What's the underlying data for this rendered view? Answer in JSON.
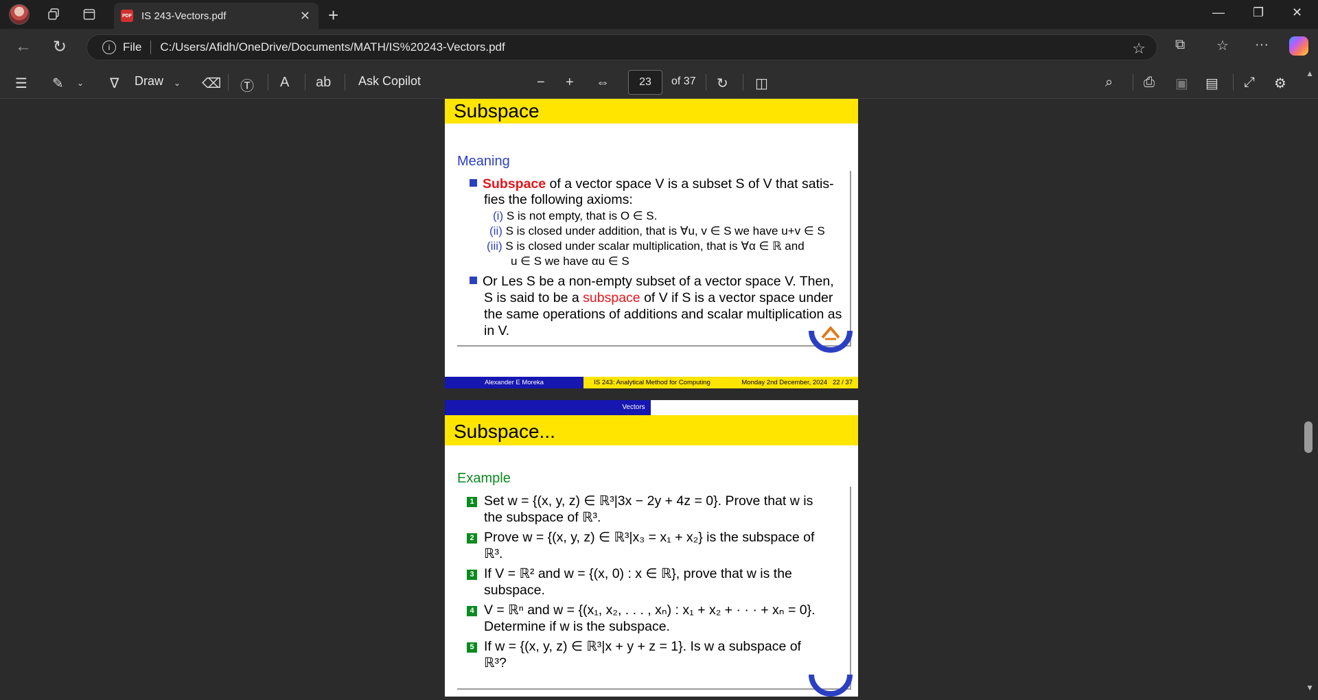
{
  "browser": {
    "tab_title": "IS 243-Vectors.pdf",
    "pdf_badge": "PDF",
    "file_label": "File",
    "url": "C:/Users/Afidh/OneDrive/Documents/MATH/IS%20243-Vectors.pdf"
  },
  "toolbar": {
    "draw_label": "Draw",
    "ask_copilot_label": "Ask Copilot",
    "translate_glyph": "ab",
    "read_aloud_glyph": "A",
    "page_current": "23",
    "page_total": "of 37"
  },
  "slide1": {
    "title": "Subspace",
    "block_title": "Meaning",
    "b1_red": "Subspace",
    "b1_rest": " of a vector space V is a subset S of V that satis-",
    "b1_line2": "fies the following axioms:",
    "i_num": "(i)",
    "i_text": "S is not empty, that is O ∈ S.",
    "ii_num": "(ii)",
    "ii_text": "S is closed under addition, that is ∀u, v ∈ S we have u+v ∈ S",
    "iii_num": "(iii)",
    "iii_text": "S is closed under scalar multiplication, that is ∀α ∈ ℝ and",
    "iii_line2": "u ∈ S we have αu ∈ S",
    "b2_line1": "Or Les S be a non-empty subset of a vector space V. Then,",
    "b2_line2a": "S is said to be a ",
    "b2_red": "subspace",
    "b2_line2b": " of V if S is a vector space under",
    "b2_line3": "the same operations of additions and scalar multiplication as",
    "b2_line4": "in V.",
    "footer_author": "Alexander E Moreka",
    "footer_course": "IS 243: Analytical Method for Computing",
    "footer_date": "Monday 2nd December, 2024",
    "footer_page": "22 / 37"
  },
  "slide2": {
    "header_label": "Vectors",
    "title": "Subspace...",
    "block_title": "Example",
    "items": [
      {
        "num": "1",
        "l1": "Set w = {(x, y, z) ∈ ℝ³|3x − 2y + 4z = 0}. Prove that w is",
        "l2": "the subspace of ℝ³."
      },
      {
        "num": "2",
        "l1": "Prove w = {(x, y, z) ∈ ℝ³|x₃ = x₁ + x₂} is the subspace of",
        "l2": "ℝ³."
      },
      {
        "num": "3",
        "l1": "If V = ℝ² and w = {(x, 0) : x ∈ ℝ}, prove that w is the",
        "l2": "subspace."
      },
      {
        "num": "4",
        "l1": "V = ℝⁿ and w = {(x₁, x₂, . . . , xₙ) : x₁ + x₂ + · · · + xₙ = 0}.",
        "l2": "Determine if w is the subspace."
      },
      {
        "num": "5",
        "l1": "If w = {(x, y, z) ∈ ℝ³|x + y + z = 1}. Is w a subspace of",
        "l2": "ℝ³?"
      }
    ]
  },
  "colors": {
    "title_band": "#ffe500",
    "footer_blue": "#1616b0",
    "red_term": "#e5151b",
    "meaning_blue": "#2b3fc3",
    "example_green": "#0a8a1f"
  }
}
